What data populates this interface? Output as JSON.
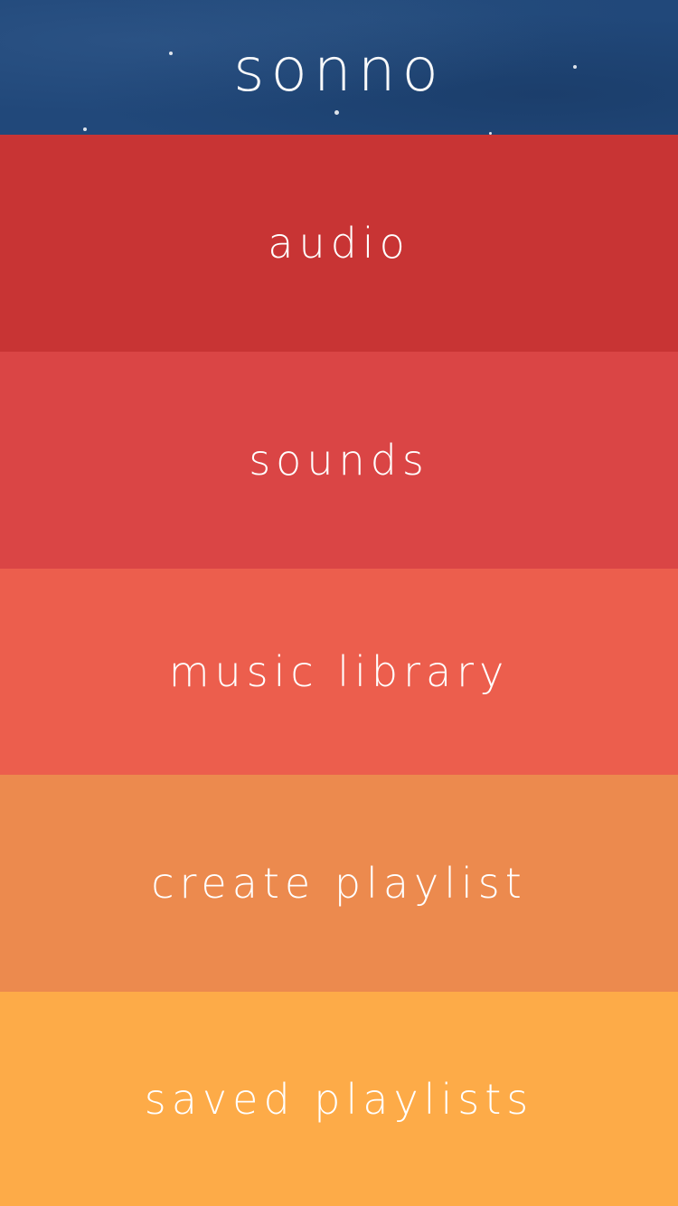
{
  "header": {
    "title": "sonno",
    "background_color": "#21487a"
  },
  "menu": {
    "items": [
      {
        "label": "audio",
        "color": "#c83434"
      },
      {
        "label": "sounds",
        "color": "#da4545"
      },
      {
        "label": "music library",
        "color": "#ec5e4d"
      },
      {
        "label": "create playlist",
        "color": "#ec8a4e"
      },
      {
        "label": "saved playlists",
        "color": "#fdab48"
      }
    ]
  }
}
